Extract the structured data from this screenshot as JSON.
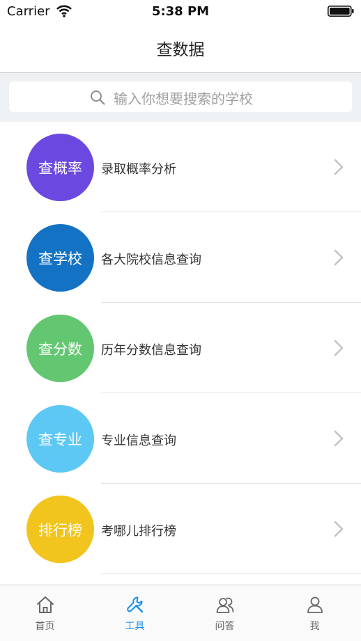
{
  "status": {
    "carrier": "Carrier",
    "time": "5:38 PM"
  },
  "nav": {
    "title": "查数据"
  },
  "search": {
    "placeholder": "输入你想要搜索的学校"
  },
  "list": [
    {
      "badge": "查概率",
      "label": "录取概率分析",
      "color": "#6b49e0"
    },
    {
      "badge": "查学校",
      "label": "各大院校信息查询",
      "color": "#1472c4"
    },
    {
      "badge": "查分数",
      "label": "历年分数信息查询",
      "color": "#63c771"
    },
    {
      "badge": "查专业",
      "label": "专业信息查询",
      "color": "#5cc8f3"
    },
    {
      "badge": "排行榜",
      "label": "考哪儿排行榜",
      "color": "#f2c41e"
    }
  ],
  "tabs": [
    {
      "label": "首页",
      "icon": "home-icon"
    },
    {
      "label": "工具",
      "icon": "wrench-icon",
      "active": true
    },
    {
      "label": "问答",
      "icon": "people-icon"
    },
    {
      "label": "我",
      "icon": "person-icon"
    }
  ]
}
